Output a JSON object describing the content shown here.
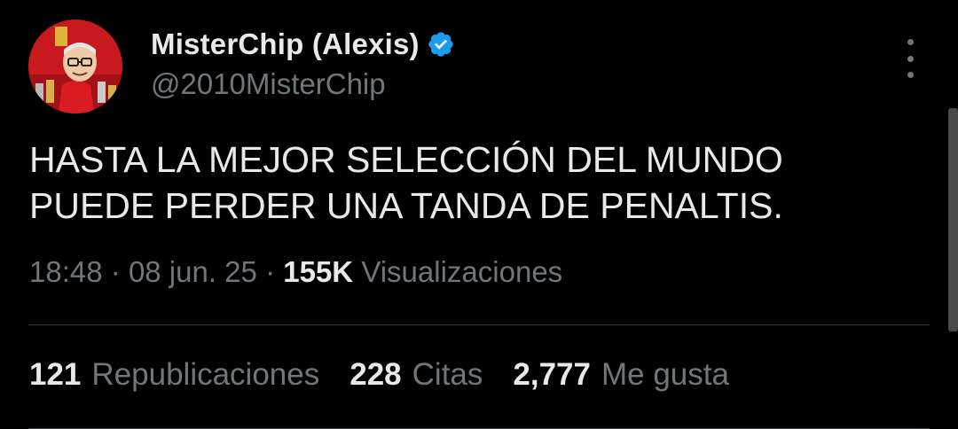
{
  "author": {
    "display_name": "MisterChip (Alexis)",
    "handle": "@2010MisterChip",
    "verified": true,
    "avatar_icon": "avatar-caricature-icon"
  },
  "tweet": {
    "lines": [
      "HASTA LA MEJOR SELECCIÓN DEL MUNDO",
      "PUEDE PERDER UNA TANDA DE PENALTIS."
    ],
    "time": "18:48",
    "separator": "·",
    "date": "08 jun. 25",
    "views_count": "155K",
    "views_label": "Visualizaciones"
  },
  "stats": {
    "reposts_count": "121",
    "reposts_label": "Republicaciones",
    "quotes_count": "228",
    "quotes_label": "Citas",
    "likes_count": "2,777",
    "likes_label": "Me gusta"
  },
  "colors": {
    "background": "#000000",
    "text_primary": "#e7e9ea",
    "text_secondary": "#71767b",
    "verified_badge": "#1d9bf0",
    "avatar_background": "#c8191e"
  },
  "icons": {
    "verified": "verified-badge-icon",
    "more": "more-vertical-icon"
  }
}
